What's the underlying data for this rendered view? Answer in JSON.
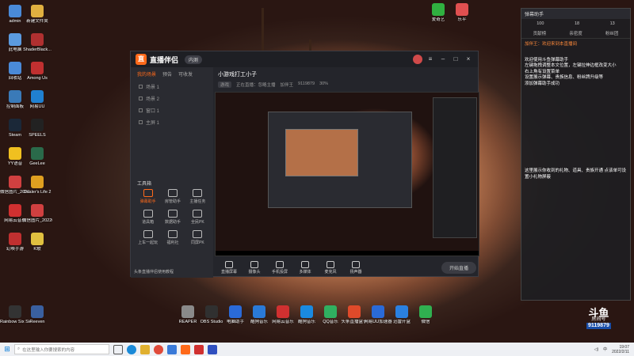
{
  "desktop_icons_left": [
    {
      "label": "admin",
      "color": "#4a8ad8"
    },
    {
      "label": "此电脑",
      "color": "#5b9be0"
    },
    {
      "label": "回收站",
      "color": "#4a8ad8"
    },
    {
      "label": "控制面板",
      "color": "#3a7ab8"
    },
    {
      "label": "Steam",
      "color": "#1b2838"
    },
    {
      "label": "YY语音",
      "color": "#f0c020"
    },
    {
      "label": "微信图片_2021121...",
      "color": "#d04040"
    },
    {
      "label": "网易云音乐",
      "color": "#d03030"
    },
    {
      "label": "幻唤手游",
      "color": "#c03030"
    }
  ],
  "desktop_icons_col2": [
    {
      "label": "新建文件夹",
      "color": "#e0b040"
    },
    {
      "label": "ShaderBlack...",
      "color": "#b03030"
    },
    {
      "label": "Among Us",
      "color": "#c03030"
    },
    {
      "label": "网易UU",
      "color": "#2080d0"
    },
    {
      "label": "SPEELS",
      "color": "#222"
    },
    {
      "label": "GeeLee",
      "color": "#2a6a4a"
    },
    {
      "label": "Dealer's Life 2",
      "color": "#e0a020"
    },
    {
      "label": "微信图片_2022011...",
      "color": "#d04040"
    },
    {
      "label": "K歌",
      "color": "#e0c040"
    }
  ],
  "desktop_icons_bottom_left": [
    {
      "label": "Rainbow Six Siege",
      "color": "#333"
    },
    {
      "label": "Reeven",
      "color": "#3a60a0"
    }
  ],
  "dock_icons": [
    {
      "label": "REAPER",
      "color": "#8a8a8a"
    },
    {
      "label": "OBS Studio",
      "color": "#303030"
    },
    {
      "label": "电脑助手",
      "color": "#2a6ad8"
    },
    {
      "label": "酷狗音乐",
      "color": "#2a7ad8"
    },
    {
      "label": "网易云音乐",
      "color": "#d03030"
    },
    {
      "label": "酷狗音乐",
      "color": "#1a8ae0"
    },
    {
      "label": "QQ音乐",
      "color": "#30b060"
    },
    {
      "label": "头条直播盒子",
      "color": "#e04a2a"
    },
    {
      "label": "网易UU加速器",
      "color": "#2a6ad8"
    },
    {
      "label": "迅雷开盒",
      "color": "#2a80e0"
    },
    {
      "label": "微信",
      "color": "#30b050"
    }
  ],
  "top_icons": [
    {
      "label": "爱奇艺",
      "color": "#30b040"
    },
    {
      "label": "乐平",
      "color": "#e05050"
    }
  ],
  "app": {
    "title": "直播伴侣",
    "version_badge": "内测",
    "left_tabs": [
      "我的场景",
      "预告",
      "可收发"
    ],
    "scenes": [
      "场景 1",
      "场景 2",
      "窗口 1",
      "主屏 1"
    ],
    "tools_header": "工具箱",
    "tools": [
      {
        "label": "弹幕助手",
        "hot": true
      },
      {
        "label": "房管助手",
        "hot": false
      },
      {
        "label": "主播任务",
        "hot": false
      },
      {
        "label": "道具箱",
        "hot": false
      },
      {
        "label": "数据助手",
        "hot": false
      },
      {
        "label": "全民PK",
        "hot": false
      },
      {
        "label": "上车一起玩",
        "hot": false
      },
      {
        "label": "福利社",
        "hot": false
      },
      {
        "label": "同屏PK",
        "hot": false
      }
    ],
    "left_note": "头条直播伴侣使用教程",
    "room_title": "小游戏打工小子",
    "room_category": "游戏",
    "room_meta": [
      "正在直播：忽略主播",
      "加伴王",
      "9119879",
      "30%"
    ],
    "bottom_buttons": [
      "直播屏幕",
      "摄像头",
      "手机投屏",
      "多媒体",
      "麦克风",
      "扬声器"
    ],
    "live_button": "开始直播"
  },
  "chat": {
    "header": "弹幕助手",
    "stats": [
      "100",
      "18",
      "13"
    ],
    "tabs": [
      "贡献榜",
      "亲密度",
      "粉丝团"
    ],
    "welcome": "加伴王：欢迎来到本直播间",
    "messages": [
      "欢迎使用斗鱼弹幕助手",
      "左键拖拽调整本文位置，左键拉伸边框改变大小",
      "右上角有设置菜单",
      "设置展示弹幕、贵族信息、粉丝牌升级等",
      "添加弹幕助手成功"
    ],
    "notice": "这里展示你收到的礼物、道具、贵族开通 点该单可设置小礼物屏蔽"
  },
  "douyu": {
    "brand": "斗鱼",
    "sub": "房间号",
    "room": "9119879"
  },
  "taskbar": {
    "search_placeholder": "在这里输入你要搜索的内容",
    "tray_text": "中",
    "time": "19:07",
    "date": "2022/2/11"
  },
  "colors": {
    "accent": "#ff6a1a",
    "window_bg": "#24252b",
    "chat_bg": "#1e1e22"
  }
}
